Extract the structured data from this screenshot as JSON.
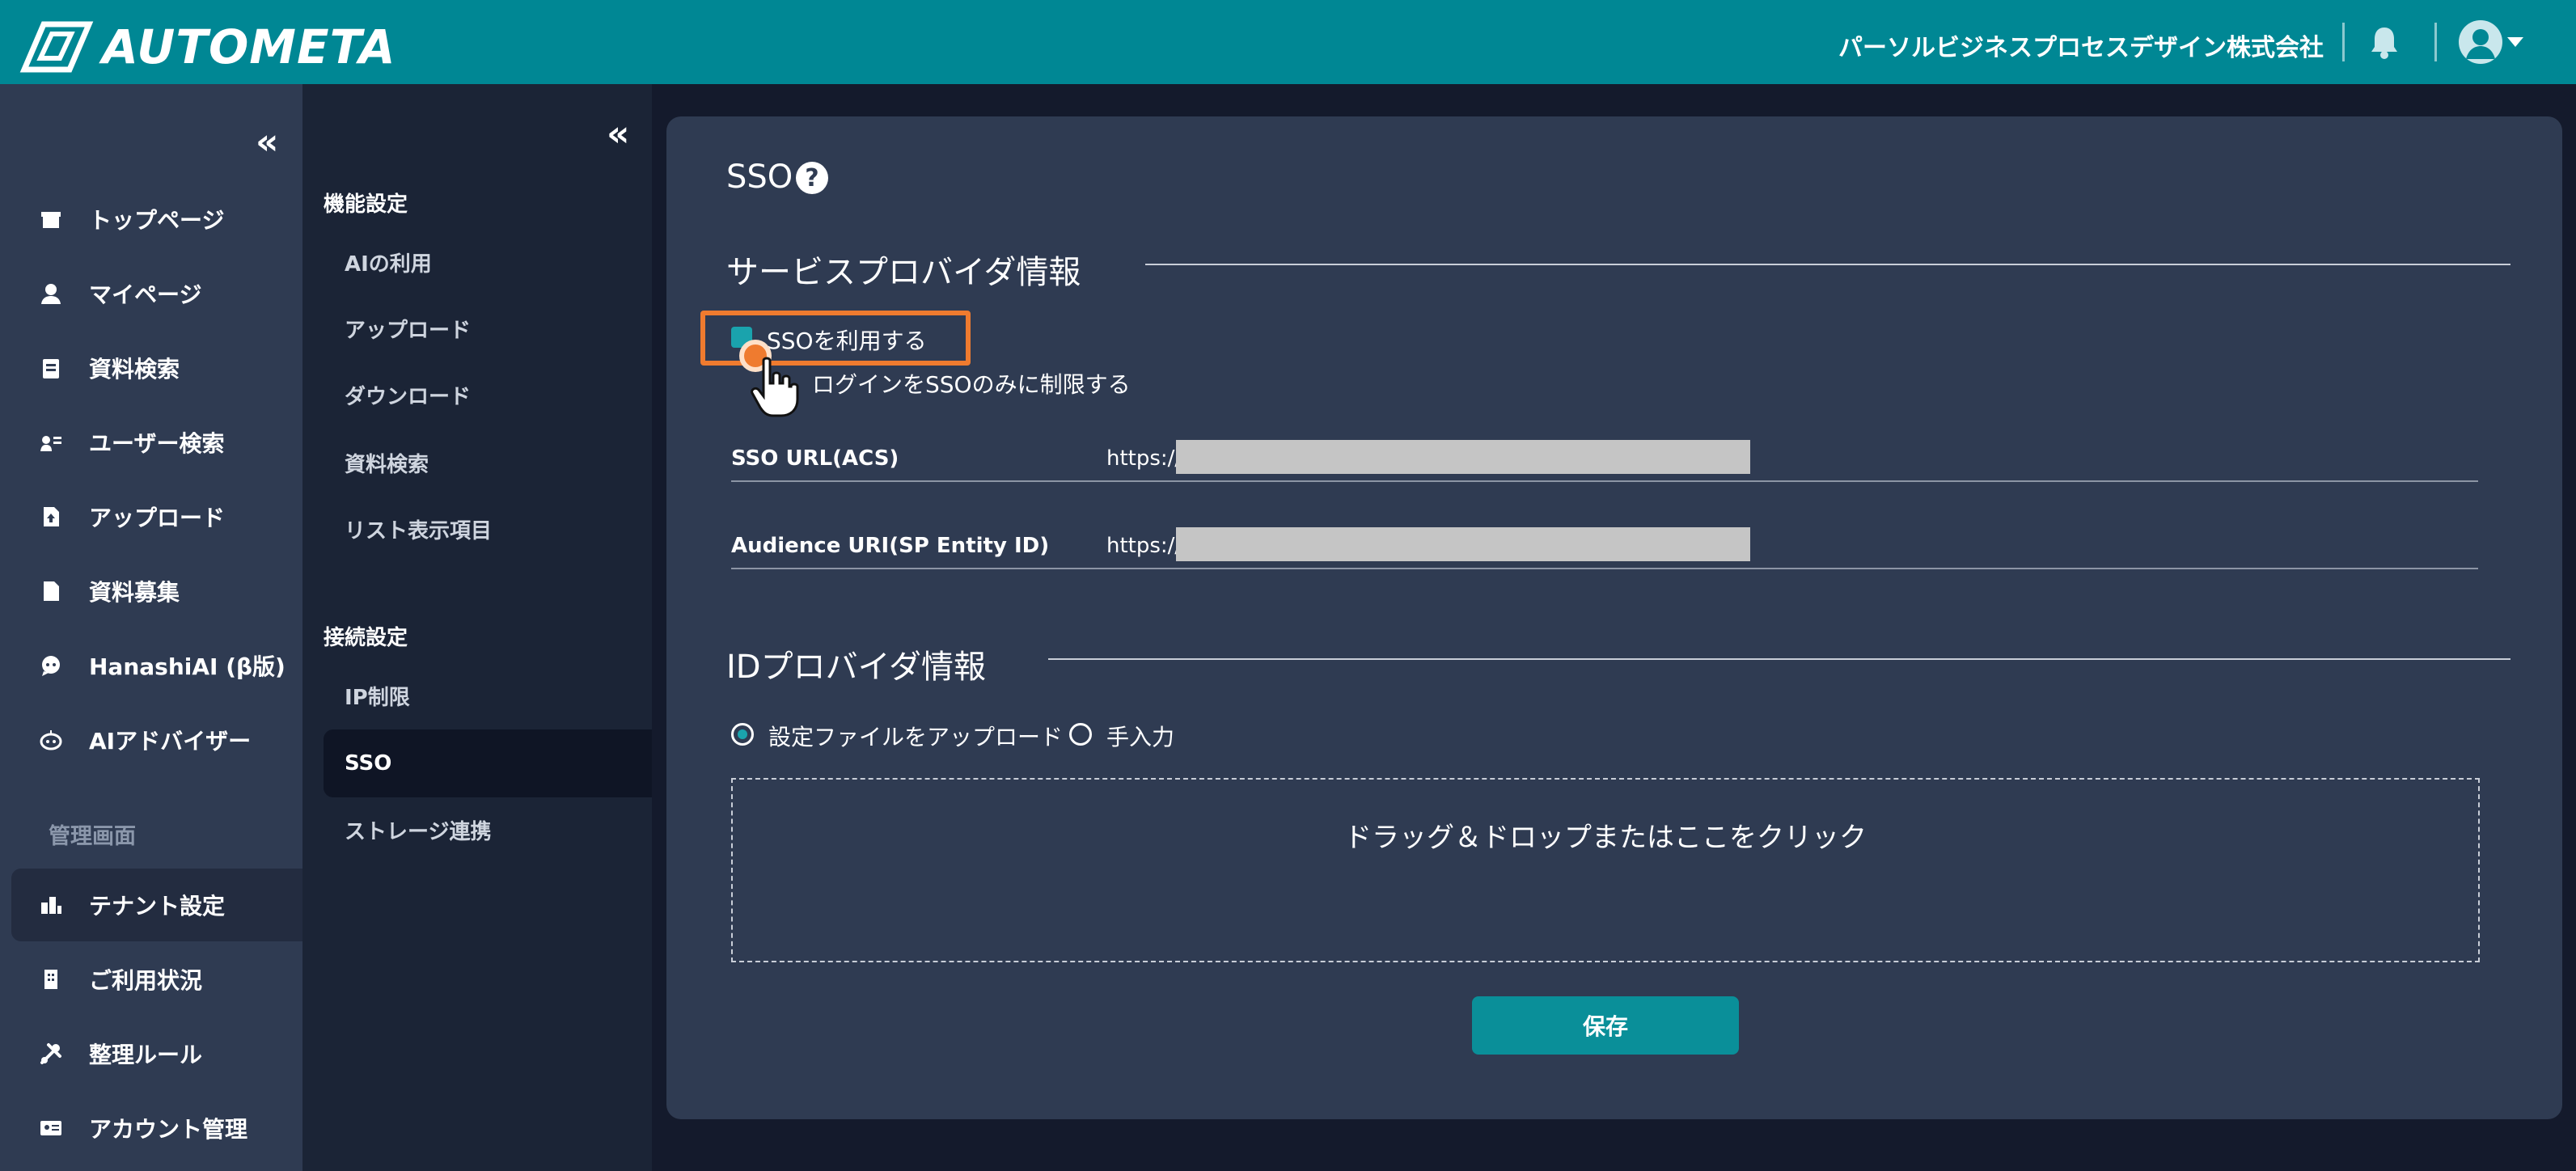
{
  "header": {
    "app_name": "AUTOMETA",
    "company": "パーソルビジネスプロセスデザイン株式会社"
  },
  "sidebar": {
    "collapse": "«",
    "items": [
      {
        "label": "トップページ",
        "icon": "store-icon"
      },
      {
        "label": "マイページ",
        "icon": "person-icon"
      },
      {
        "label": "資料検索",
        "icon": "document-search-icon"
      },
      {
        "label": "ユーザー検索",
        "icon": "user-search-icon"
      },
      {
        "label": "アップロード",
        "icon": "file-upload-icon"
      },
      {
        "label": "資料募集",
        "icon": "file-icon"
      },
      {
        "label": "HanashiAI (β版)",
        "icon": "chat-bubble-icon"
      },
      {
        "label": "AIアドバイザー",
        "icon": "robot-icon"
      }
    ],
    "admin_label": "管理画面",
    "admin_items": [
      {
        "label": "テナント設定",
        "icon": "tenant-icon",
        "active": true
      },
      {
        "label": "ご利用状況",
        "icon": "building-icon"
      },
      {
        "label": "整理ルール",
        "icon": "tools-icon"
      },
      {
        "label": "アカウント管理",
        "icon": "id-card-icon"
      }
    ]
  },
  "subnav": {
    "collapse": "«",
    "groups": [
      {
        "heading": "機能設定",
        "items": [
          "AIの利用",
          "アップロード",
          "ダウンロード",
          "資料検索",
          "リスト表示項目"
        ]
      },
      {
        "heading": "接続設定",
        "items": [
          "IP制限",
          "SSO",
          "ストレージ連携"
        ]
      }
    ],
    "active": "SSO"
  },
  "main": {
    "title": "SSO",
    "help": "?",
    "sp_section": "サービスプロバイダ情報",
    "use_sso_label": "SSOを利用する",
    "use_sso_checked": true,
    "restrict_label": "ログインをSSOのみに制限する",
    "fields": [
      {
        "label": "SSO URL(ACS)",
        "prefix": "https://"
      },
      {
        "label": "Audience URI(SP Entity ID)",
        "prefix": "https://"
      }
    ],
    "idp_section": "IDプロバイダ情報",
    "idp_options": [
      "設定ファイルをアップロード",
      "手入力"
    ],
    "idp_selected": "設定ファイルをアップロード",
    "dropzone_text": "ドラッグ＆ドロップまたはここをクリック",
    "save_label": "保存"
  },
  "colors": {
    "header": "#008794",
    "accent": "#1aa3ad",
    "highlight": "#ef7b2f",
    "panel": "#2f3b52",
    "background": "#141a2c"
  }
}
